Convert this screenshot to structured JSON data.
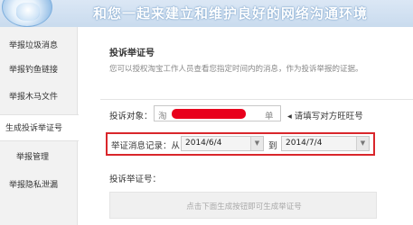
{
  "banner": {
    "slogan": "和您一起来建立和维护良好的网络沟通环境"
  },
  "sidebar": {
    "items": [
      {
        "label": "举报垃圾消息",
        "active": false
      },
      {
        "label": "举报钓鱼链接",
        "active": false
      },
      {
        "label": "举报木马文件",
        "active": false
      },
      {
        "label": "生成投诉举证号",
        "active": true
      },
      {
        "label": "举报管理",
        "active": false
      },
      {
        "label": "举报隐私泄漏",
        "active": false
      }
    ]
  },
  "main": {
    "title": "投诉举证号",
    "description": "您可以授权淘宝工作人员查看您指定时间内的消息，作为投诉举报的证据。",
    "complaint_target_label": "投诉对象：",
    "target_input_prefix": "淘",
    "target_input_suffix": "单",
    "target_hint": "请填写对方旺旺号",
    "evidence_label": "举证消息记录：从",
    "date_from": "2014/6/4",
    "to_label": "到",
    "date_to": "2014/7/4",
    "evidence_number_label": "投诉举证号：",
    "generate_hint": "点击下面生成按钮即可生成举证号"
  }
}
